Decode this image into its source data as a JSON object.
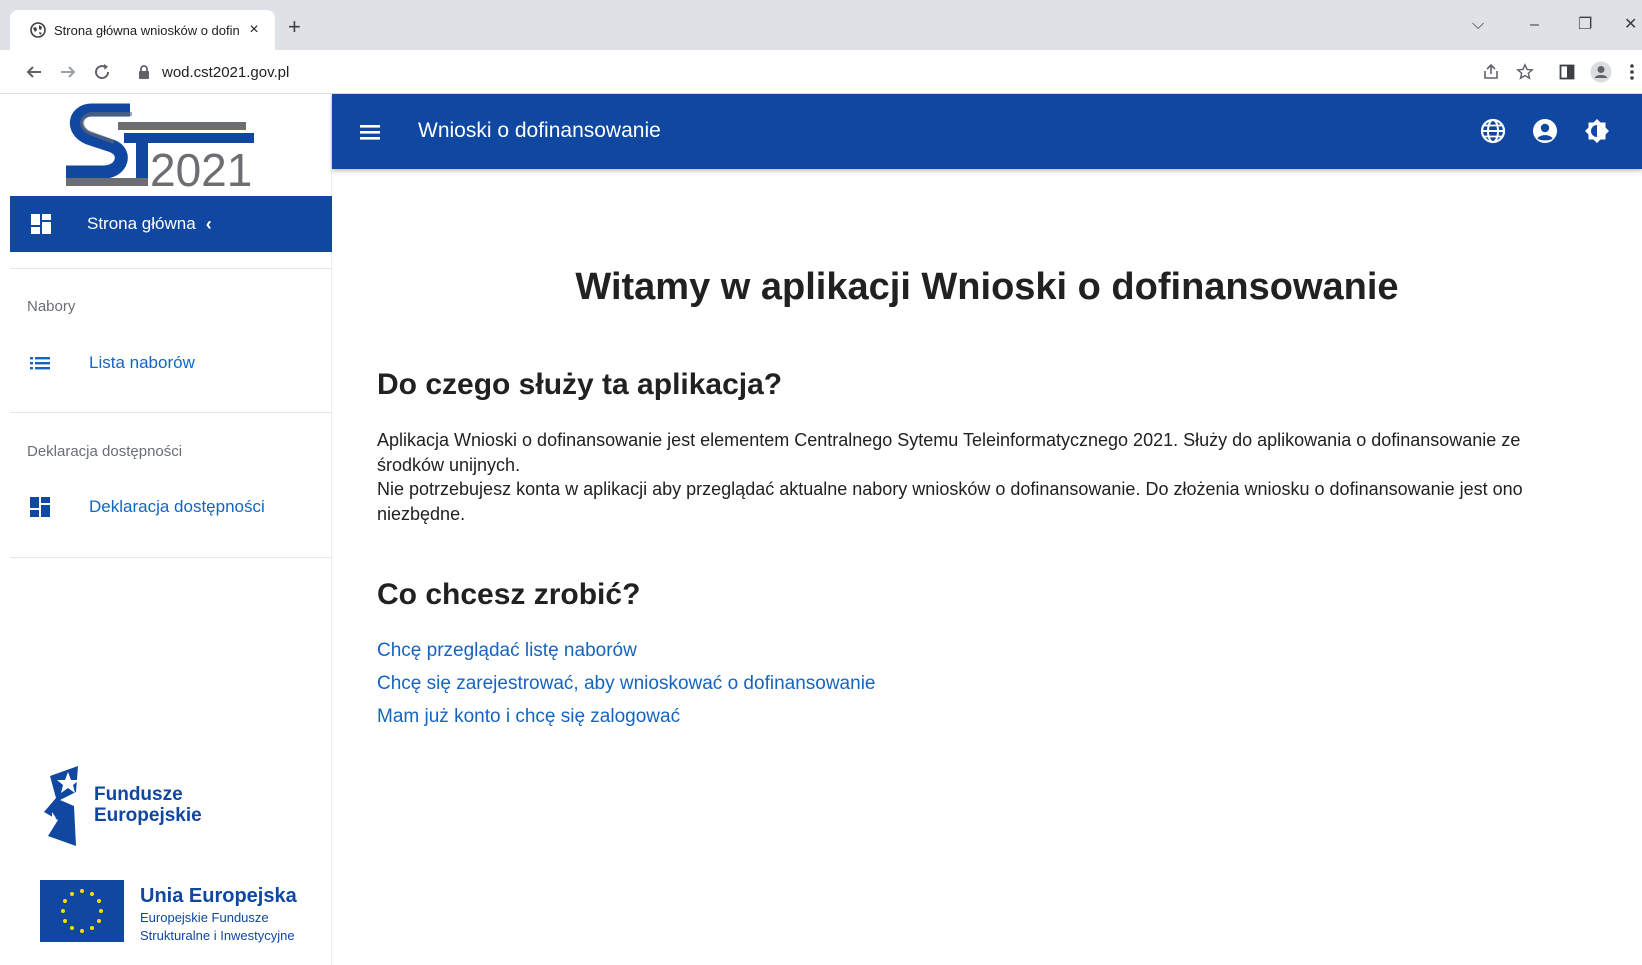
{
  "browser": {
    "tab_title": "Strona główna wniosków o dofin",
    "tab_close": "×",
    "new_tab": "+",
    "url": "wod.cst2021.gov.pl",
    "controls": {
      "dropdown": "⌵",
      "minimize": "–",
      "restore": "❐",
      "close": "✕"
    }
  },
  "sidebar": {
    "logo_text": "2021",
    "home_label": "Strona główna",
    "home_chevron": "‹",
    "sections": [
      {
        "title": "Nabory",
        "link": "Lista naborów"
      },
      {
        "title": "Deklaracja dostępności",
        "link": "Deklaracja dostępności"
      }
    ],
    "fe_logo": {
      "line1": "Fundusze",
      "line2": "Europejskie"
    },
    "ue_logo": {
      "title": "Unia Europejska",
      "line1": "Europejskie Fundusze",
      "line2": "Strukturalne i Inwestycyjne"
    }
  },
  "appbar": {
    "title": "Wnioski o dofinansowanie"
  },
  "main": {
    "welcome": "Witamy w aplikacji Wnioski o dofinansowanie",
    "about_heading": "Do czego służy ta aplikacja?",
    "about_p1": "Aplikacja Wnioski o dofinansowanie jest elementem Centralnego Sytemu Teleinformatycznego 2021. Służy do aplikowania o dofinansowanie ze środków unijnych.",
    "about_p2": "Nie potrzebujesz konta w aplikacji aby przeglądać aktualne nabory wniosków o dofinansowanie. Do złożenia wniosku o dofinansowanie jest ono niezbędne.",
    "actions_heading": "Co chcesz zrobić?",
    "actions": [
      "Chcę przeglądać listę naborów",
      "Chcę się zarejestrować, aby wnioskować o dofinansowanie",
      "Mam już konto i chcę się zalogować"
    ]
  },
  "colors": {
    "primary": "#0f47a1",
    "link": "#1565c0",
    "text": "#212121",
    "muted": "#6b6f75"
  }
}
